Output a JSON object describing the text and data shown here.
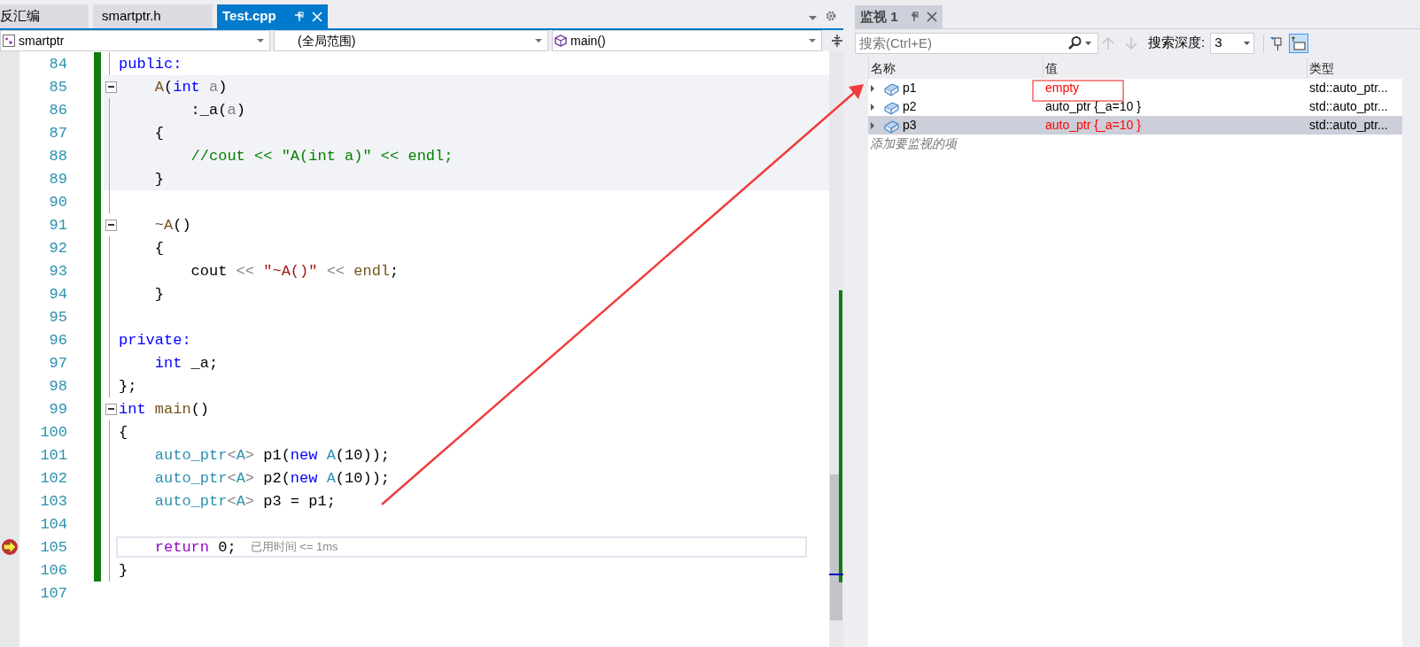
{
  "editor": {
    "tabs": [
      {
        "label": "反汇编",
        "selected": false
      },
      {
        "label": "smartptr.h",
        "selected": false
      },
      {
        "label": "Test.cpp",
        "selected": true
      }
    ],
    "navigation": [
      {
        "label": "smartptr",
        "kind": "class"
      },
      {
        "label": "(全局范围)",
        "kind": "scope"
      },
      {
        "label": "main()",
        "kind": "function"
      }
    ],
    "lines": [
      {
        "number": "84",
        "fold": false,
        "shaded": false,
        "current": false,
        "changed": true,
        "tokens": [
          {
            "text": "public:",
            "kind": "kw"
          }
        ]
      },
      {
        "number": "85",
        "fold": true,
        "shaded": true,
        "current": false,
        "changed": true,
        "tokens": [
          {
            "text": "    A",
            "kind": "func"
          },
          {
            "text": "(",
            "kind": "plain"
          },
          {
            "text": "int",
            "kind": "kw"
          },
          {
            "text": " a",
            "kind": "param"
          },
          {
            "text": ")",
            "kind": "plain"
          }
        ]
      },
      {
        "number": "86",
        "fold": false,
        "shaded": true,
        "current": false,
        "changed": true,
        "tokens": [
          {
            "text": "        :_a(",
            "kind": "plain"
          },
          {
            "text": "a",
            "kind": "param"
          },
          {
            "text": ")",
            "kind": "plain"
          }
        ]
      },
      {
        "number": "87",
        "fold": false,
        "shaded": true,
        "current": false,
        "changed": true,
        "tokens": [
          {
            "text": "    {",
            "kind": "plain"
          }
        ]
      },
      {
        "number": "88",
        "fold": false,
        "shaded": true,
        "current": false,
        "changed": true,
        "tokens": [
          {
            "text": "        //cout << \"A(int a)\" << endl;",
            "kind": "comment"
          }
        ]
      },
      {
        "number": "89",
        "fold": false,
        "shaded": true,
        "current": false,
        "changed": true,
        "tokens": [
          {
            "text": "    }",
            "kind": "plain"
          }
        ]
      },
      {
        "number": "90",
        "fold": false,
        "shaded": false,
        "current": false,
        "changed": true
      },
      {
        "number": "91",
        "fold": true,
        "shaded": false,
        "current": false,
        "changed": true,
        "tokens": [
          {
            "text": "    ~A",
            "kind": "func"
          },
          {
            "text": "()",
            "kind": "plain"
          }
        ]
      },
      {
        "number": "92",
        "fold": false,
        "shaded": false,
        "current": false,
        "changed": true,
        "tokens": [
          {
            "text": "    {",
            "kind": "plain"
          }
        ]
      },
      {
        "number": "93",
        "fold": false,
        "shaded": false,
        "current": false,
        "changed": true,
        "tokens": [
          {
            "text": "        cout",
            "kind": "plain"
          },
          {
            "text": " << ",
            "kind": "op"
          },
          {
            "text": "\"~A()\"",
            "kind": "string"
          },
          {
            "text": " << ",
            "kind": "op"
          },
          {
            "text": "endl",
            "kind": "func"
          },
          {
            "text": ";",
            "kind": "plain"
          }
        ]
      },
      {
        "number": "94",
        "fold": false,
        "shaded": false,
        "current": false,
        "changed": true,
        "tokens": [
          {
            "text": "    }",
            "kind": "plain"
          }
        ]
      },
      {
        "number": "95",
        "fold": false,
        "shaded": false,
        "current": false,
        "changed": true
      },
      {
        "number": "96",
        "fold": false,
        "shaded": false,
        "current": false,
        "changed": true,
        "tokens": [
          {
            "text": "private:",
            "kind": "kw"
          }
        ]
      },
      {
        "number": "97",
        "fold": false,
        "shaded": false,
        "current": false,
        "changed": true,
        "tokens": [
          {
            "text": "    int",
            "kind": "kw"
          },
          {
            "text": " _a;",
            "kind": "plain"
          }
        ]
      },
      {
        "number": "98",
        "fold": false,
        "shaded": false,
        "current": false,
        "changed": true,
        "tokens": [
          {
            "text": "};",
            "kind": "plain"
          }
        ]
      },
      {
        "number": "99",
        "fold": true,
        "shaded": false,
        "current": false,
        "changed": true,
        "tokens": [
          {
            "text": "int",
            "kind": "kw"
          },
          {
            "text": " main",
            "kind": "func"
          },
          {
            "text": "()",
            "kind": "plain"
          }
        ]
      },
      {
        "number": "100",
        "fold": false,
        "shaded": false,
        "current": false,
        "changed": true,
        "tokens": [
          {
            "text": "{",
            "kind": "plain"
          }
        ]
      },
      {
        "number": "101",
        "fold": false,
        "shaded": false,
        "current": false,
        "changed": true,
        "tokens": [
          {
            "text": "    auto_ptr",
            "kind": "type"
          },
          {
            "text": "<",
            "kind": "op"
          },
          {
            "text": "A",
            "kind": "type"
          },
          {
            "text": "> ",
            "kind": "op"
          },
          {
            "text": "p1(",
            "kind": "plain"
          },
          {
            "text": "new",
            "kind": "kw"
          },
          {
            "text": " A",
            "kind": "type"
          },
          {
            "text": "(10));",
            "kind": "plain"
          }
        ]
      },
      {
        "number": "102",
        "fold": false,
        "shaded": false,
        "current": false,
        "changed": true,
        "tokens": [
          {
            "text": "    auto_ptr",
            "kind": "type"
          },
          {
            "text": "<",
            "kind": "op"
          },
          {
            "text": "A",
            "kind": "type"
          },
          {
            "text": "> ",
            "kind": "op"
          },
          {
            "text": "p2(",
            "kind": "plain"
          },
          {
            "text": "new",
            "kind": "kw"
          },
          {
            "text": " A",
            "kind": "type"
          },
          {
            "text": "(10));",
            "kind": "plain"
          }
        ]
      },
      {
        "number": "103",
        "fold": false,
        "shaded": false,
        "current": false,
        "changed": true,
        "tokens": [
          {
            "text": "    auto_ptr",
            "kind": "type"
          },
          {
            "text": "<",
            "kind": "op"
          },
          {
            "text": "A",
            "kind": "type"
          },
          {
            "text": "> ",
            "kind": "op"
          },
          {
            "text": "p3 = p1;",
            "kind": "plain"
          }
        ]
      },
      {
        "number": "104",
        "fold": false,
        "shaded": false,
        "current": false,
        "changed": true
      },
      {
        "number": "105",
        "fold": false,
        "shaded": false,
        "current": true,
        "changed": true,
        "tokens": [
          {
            "text": "    return",
            "kind": "ctrl"
          },
          {
            "text": " 0;",
            "kind": "plain"
          }
        ],
        "hint": "已用时间 <= 1ms"
      },
      {
        "number": "106",
        "fold": false,
        "shaded": false,
        "current": false,
        "changed": true,
        "tokens": [
          {
            "text": "}",
            "kind": "plain"
          }
        ]
      },
      {
        "number": "107",
        "fold": false,
        "shaded": false,
        "current": false,
        "changed": false
      }
    ]
  },
  "watch": {
    "tab": {
      "label": "监视 1",
      "selected": true
    },
    "search": {
      "placeholder": "搜索(Ctrl+E)"
    },
    "depth_label": "搜索深度:",
    "depth": "3",
    "columns": [
      "名称",
      "值",
      "类型"
    ],
    "rows": [
      {
        "name": "p1",
        "value": "empty",
        "type": "std::auto_ptr...",
        "changed": true,
        "selected": false
      },
      {
        "name": "p2",
        "value": "auto_ptr {_a=10 }",
        "type": "std::auto_ptr...",
        "changed": false,
        "selected": false
      },
      {
        "name": "p3",
        "value": "auto_ptr {_a=10 }",
        "type": "std::auto_ptr...",
        "changed": true,
        "selected": true
      }
    ],
    "add_placeholder": "添加要监视的项"
  }
}
